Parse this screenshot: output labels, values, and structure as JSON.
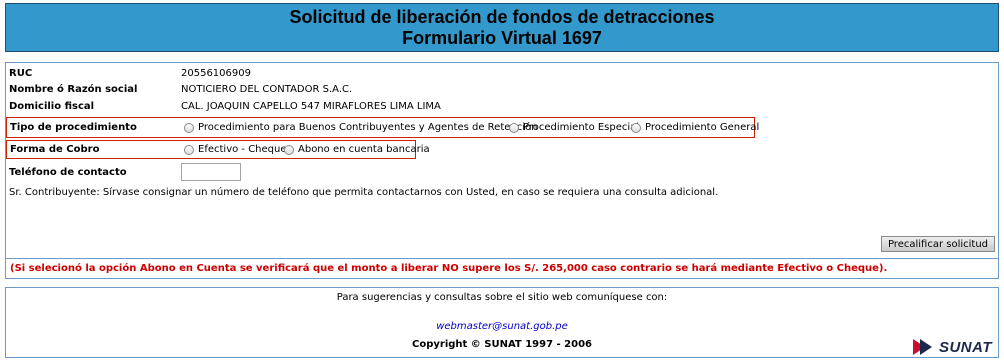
{
  "header": {
    "title_line1": "Solicitud de liberación de fondos de detracciones",
    "title_line2": "Formulario Virtual 1697"
  },
  "form": {
    "ruc_label": "RUC",
    "ruc_value": "20556106909",
    "razon_label": "Nombre ó Razón social",
    "razon_value": "NOTICIERO DEL CONTADOR S.A.C.",
    "domicilio_label": "Domicilio fiscal",
    "domicilio_value": "CAL. JOAQUIN CAPELLO 547 MIRAFLORES LIMA LIMA",
    "tipo_label": "Tipo de procedimiento",
    "tipo_options": [
      "Procedimiento para Buenos Contribuyentes y Agentes de Retención",
      "Procedimiento Especial",
      "Procedimiento General"
    ],
    "cobro_label": "Forma de Cobro",
    "cobro_options": [
      "Efectivo - Cheque",
      "Abono en cuenta bancaria"
    ],
    "telefono_label": "Teléfono de contacto",
    "telefono_value": "",
    "info_text": "Sr. Contribuyente: Sírvase consignar un número de teléfono que permita contactarnos con Usted, en caso se requiera una consulta adicional.",
    "precalificar_label": "Precalificar solicitud"
  },
  "warning": {
    "text": "(Si selecionó la opción Abono en Cuenta se verificará que el monto a liberar NO supere los S/. 265,000 caso contrario se hará mediante Efectivo o Cheque)."
  },
  "footer": {
    "message": "Para sugerencias y consultas sobre el sitio web comuníquese con:",
    "email": "webmaster@sunat.gob.pe",
    "copyright": "Copyright © SUNAT 1997 - 2006",
    "logo_text": "SUNAT"
  },
  "colors": {
    "header_bg": "#3399cc",
    "highlight_border": "#cc2200",
    "warning_text": "#cc0000",
    "link": "#0000cc"
  }
}
